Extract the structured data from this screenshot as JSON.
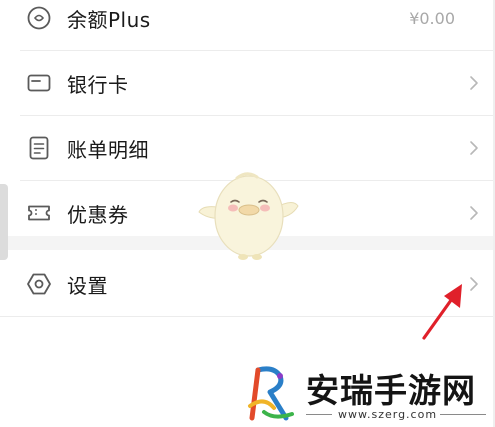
{
  "menu": {
    "items": [
      {
        "label": "余额Plus",
        "value": "¥0.00",
        "icon": "coin-icon"
      },
      {
        "label": "银行卡",
        "icon": "bank-card-icon"
      },
      {
        "label": "账单明细",
        "icon": "bill-icon"
      },
      {
        "label": "优惠券",
        "icon": "coupon-icon"
      },
      {
        "label": "设置",
        "icon": "settings-gear-icon"
      }
    ]
  },
  "watermark": {
    "title": "安瑞手游网",
    "url": "www.szerg.com",
    "logo_text": "R"
  },
  "colors": {
    "arrow": "#e0202a",
    "icon_stroke": "#5a5a5a",
    "chevron": "#b8b8b8",
    "section_gap": "#f4f4f4"
  }
}
